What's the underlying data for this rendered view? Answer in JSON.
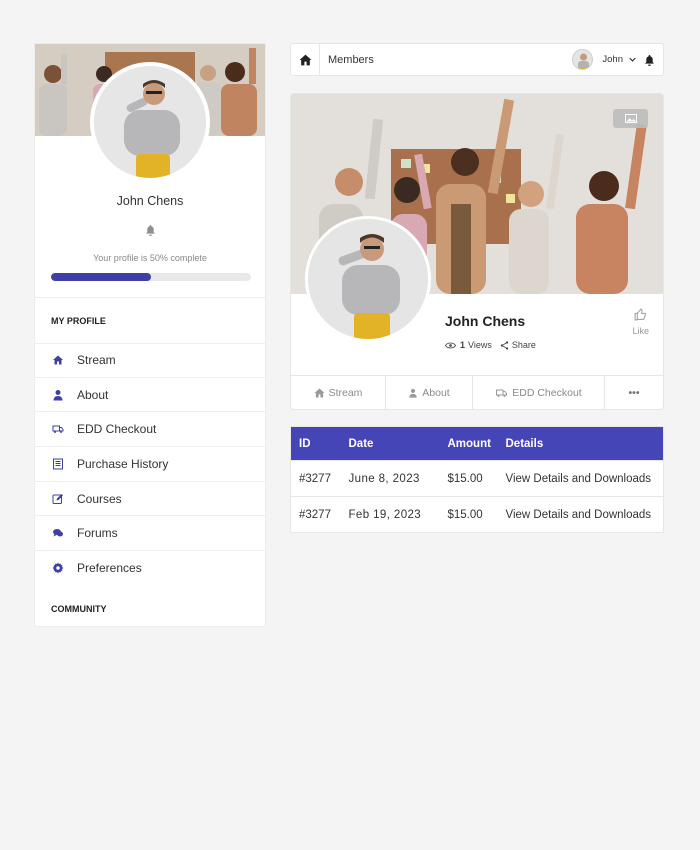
{
  "sidebar": {
    "name": "John Chens",
    "progress_text": "Your profile is 50% complete",
    "progress_value": 0.5,
    "section_profile": "MY PROFILE",
    "section_community": "COMMUNITY",
    "items": [
      {
        "label": "Stream",
        "icon": "home-icon"
      },
      {
        "label": "About",
        "icon": "user-icon"
      },
      {
        "label": "EDD Checkout",
        "icon": "truck-icon"
      },
      {
        "label": "Purchase History",
        "icon": "receipt-icon"
      },
      {
        "label": "Courses",
        "icon": "edit-icon"
      },
      {
        "label": "Forums",
        "icon": "comments-icon"
      },
      {
        "label": "Preferences",
        "icon": "gear-icon"
      }
    ]
  },
  "topbar": {
    "breadcrumb": "Members",
    "username": "John"
  },
  "profile": {
    "name": "John Chens",
    "views_count": "1",
    "views_label": "Views",
    "share_label": "Share",
    "like_label": "Like",
    "tabs": [
      {
        "label": "Stream",
        "icon": "home-icon"
      },
      {
        "label": "About",
        "icon": "user-icon"
      },
      {
        "label": "EDD Checkout",
        "icon": "truck-icon"
      },
      {
        "label": "•••",
        "icon": "more-icon"
      }
    ]
  },
  "orders": {
    "columns": [
      "ID",
      "Date",
      "Amount",
      "Details"
    ],
    "rows": [
      {
        "id": "#3277",
        "date": "June 8, 2023",
        "amount": "$15.00",
        "details": "View Details and Downloads"
      },
      {
        "id": "#3277",
        "date": "Feb 19, 2023",
        "amount": "$15.00",
        "details": "View Details and Downloads"
      }
    ]
  },
  "colors": {
    "accent": "#4545b8",
    "progress": "#3f3fa6",
    "background": "#f4f4f4"
  }
}
